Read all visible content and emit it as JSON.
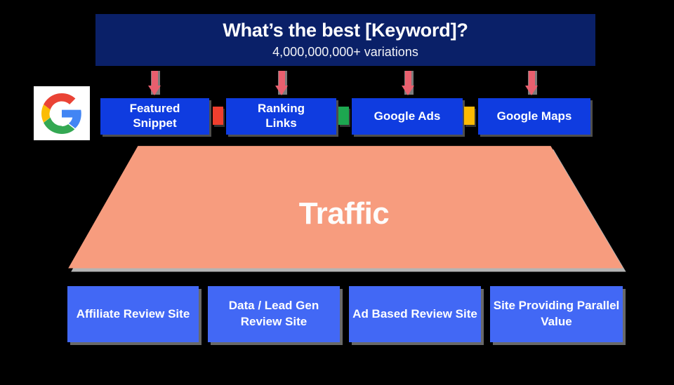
{
  "colors": {
    "background": "#000000",
    "header_navy": "#0A2068",
    "serp_blue": "#0F3CE0",
    "site_blue": "#4268F5",
    "traffic_salmon": "#F79C7E",
    "arrow_coral": "#E85F6E",
    "shadow_gray": "#B4B4B4",
    "google_red": "#EA4335",
    "google_yellow": "#FBBC05",
    "google_green": "#34A853",
    "google_blue": "#4285F4",
    "text_white": "#FFFFFF"
  },
  "header": {
    "title": "What’s the best [Keyword]?",
    "subtitle": "4,000,000,000+ variations"
  },
  "brand": {
    "logo_name": "google-logo-icon",
    "logo_letter": "G"
  },
  "arrows": {
    "icon_name": "arrow-down-icon",
    "count": 4
  },
  "serp_features": [
    {
      "line1": "Featured",
      "line2": "Snippet"
    },
    {
      "line1": "Ranking",
      "line2": "Links"
    },
    {
      "line1": "Google Ads",
      "line2": ""
    },
    {
      "line1": "Google Maps",
      "line2": ""
    }
  ],
  "separators": [
    {
      "name": "separator-red",
      "color": "#F03F2E"
    },
    {
      "name": "separator-green",
      "color": "#1DA750"
    },
    {
      "name": "separator-yellow",
      "color": "#FCBA03"
    }
  ],
  "traffic": {
    "label": "Traffic"
  },
  "site_types": [
    {
      "line1": "Affiliate",
      "line2": "Review Site"
    },
    {
      "line1": "Data / Lead Gen",
      "line2": "Review Site"
    },
    {
      "line1": "Ad Based",
      "line2": "Review Site"
    },
    {
      "line1": "Site Providing",
      "line2": "Parallel Value"
    }
  ]
}
